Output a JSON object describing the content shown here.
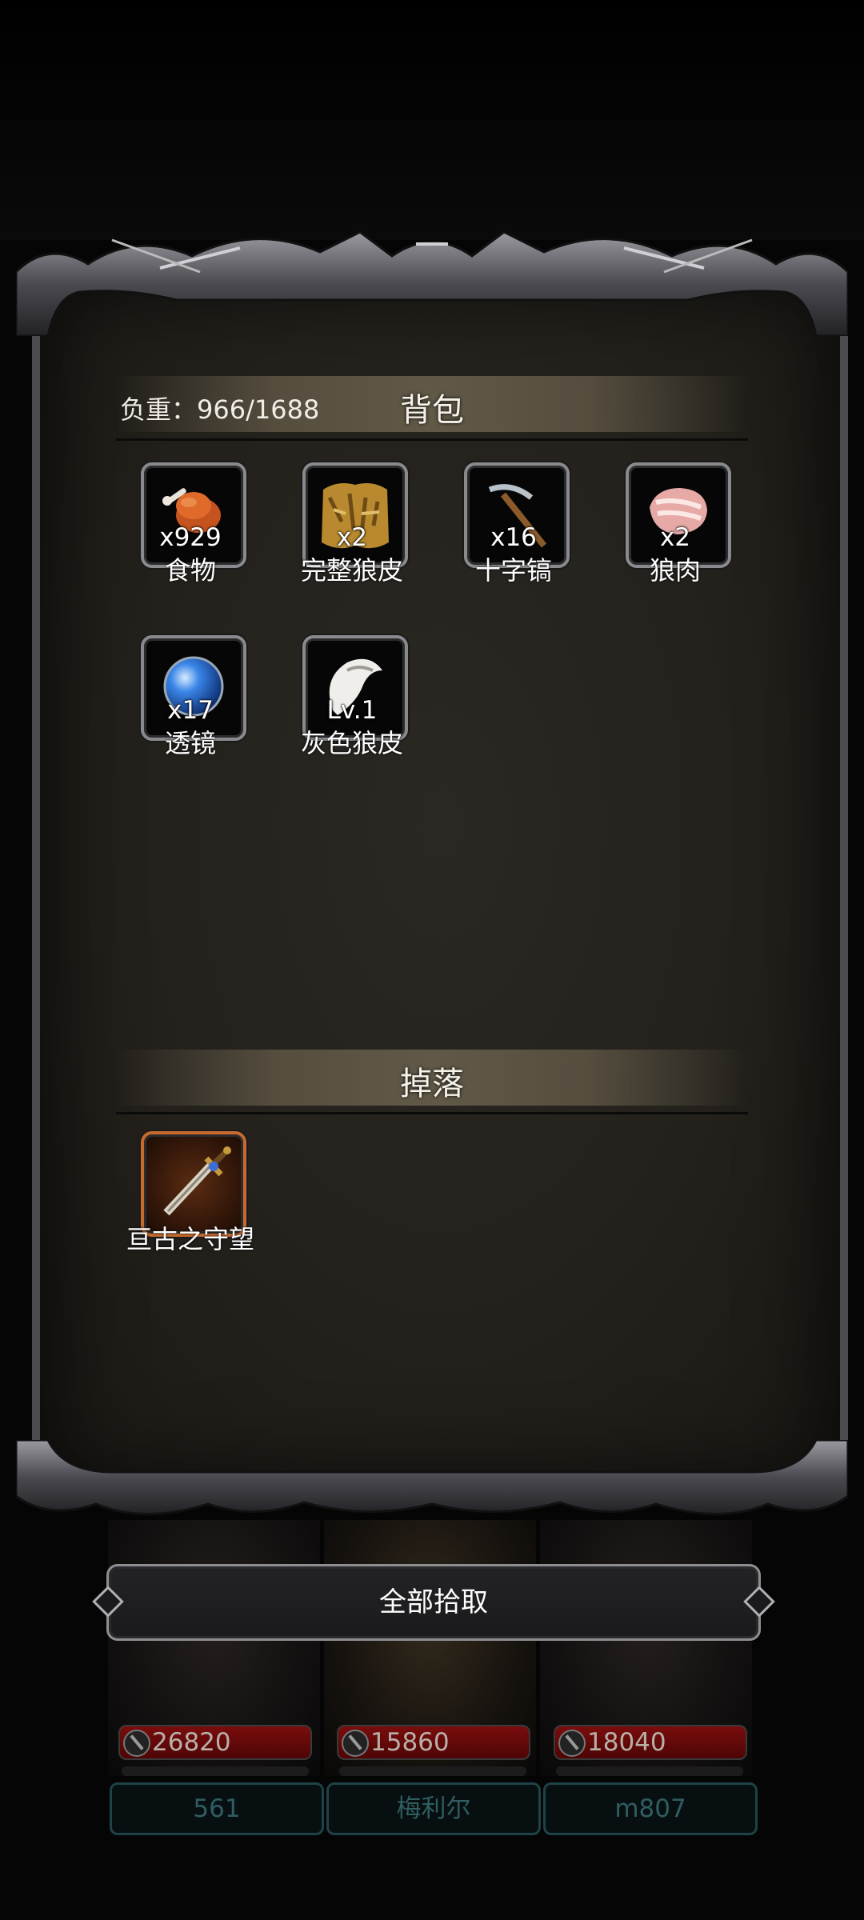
{
  "inventory": {
    "title": "背包",
    "weight_label": "负重：966/1688",
    "items": [
      {
        "name": "食物",
        "qty": "x929",
        "icon": "roast-meat-icon"
      },
      {
        "name": "完整狼皮",
        "qty": "x2",
        "icon": "wolf-pelt-icon"
      },
      {
        "name": "十字镐",
        "qty": "x16",
        "icon": "pickaxe-icon"
      },
      {
        "name": "狼肉",
        "qty": "x2",
        "icon": "raw-meat-icon"
      },
      {
        "name": "透镜",
        "qty": "x17",
        "icon": "lens-icon"
      },
      {
        "name": "灰色狼皮",
        "qty": "Lv.1",
        "icon": "grey-pelt-icon"
      }
    ]
  },
  "drops": {
    "title": "掉落",
    "items": [
      {
        "name": "亘古之守望",
        "icon": "sword-icon",
        "rarity_color": "#c86a2e"
      }
    ]
  },
  "actions": {
    "pickup_all": "全部拾取"
  },
  "team": [
    {
      "hp": "26820",
      "name": "561"
    },
    {
      "hp": "15860",
      "name": "梅利尔"
    },
    {
      "hp": "18040",
      "name": "m807"
    }
  ],
  "colors": {
    "hp_bar": "#7a0d0d",
    "name_text": "#2f5d62",
    "drop_border": "#c86a2e"
  }
}
